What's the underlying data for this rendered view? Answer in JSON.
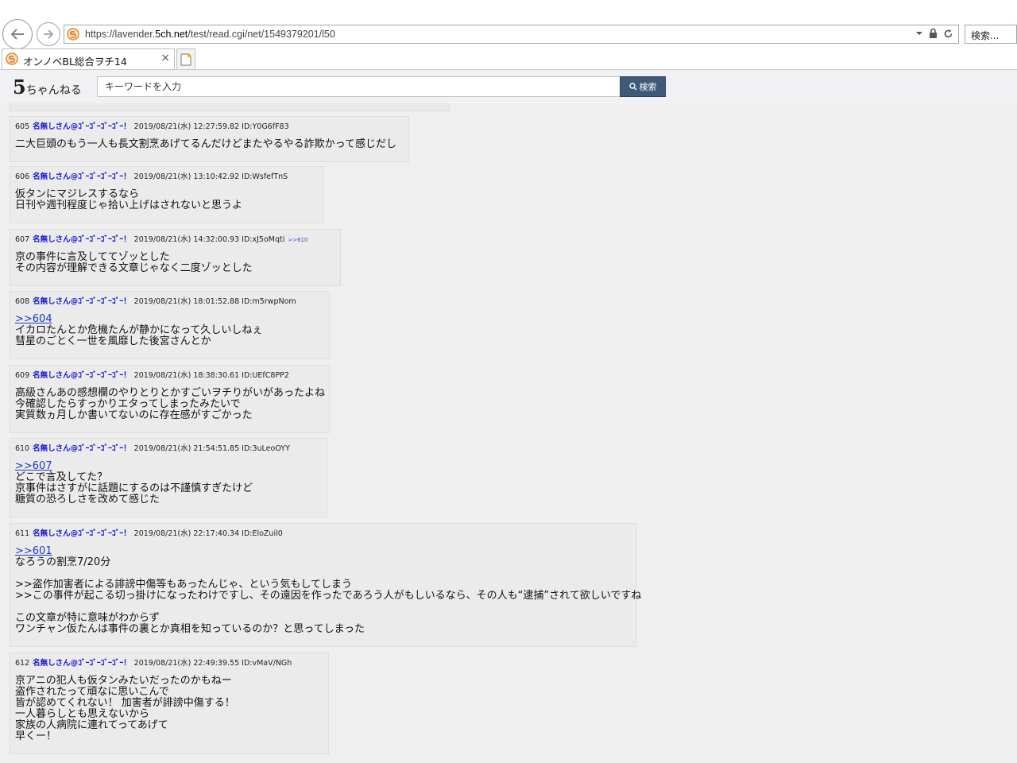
{
  "browser": {
    "url_prefix": "https://lavender.",
    "url_domain": "5ch.net",
    "url_path": "/test/read.cgi/net/1549379201/l50",
    "search_placeholder": "検索...",
    "tab_title": "オンノベBL総合ヲチ14",
    "tab_close": "×"
  },
  "site": {
    "logo_five": "5",
    "logo_rest": "ちゃんねる",
    "keyword_placeholder": "キーワードを入力",
    "search_label": "検索"
  },
  "posts": [
    {
      "num": "605",
      "name": "名無しさん@ｺﾞｰｺﾞｰｺﾞｰｺﾞｰ！",
      "datetime": "2019/08/21(水) 12:27:59.82",
      "id": "ID:Y0G6fF83",
      "tag": "",
      "lines": [
        "二大巨頭のもう一人も長文割烹あげてるんだけどまたやるやる詐欺かって感じだし"
      ]
    },
    {
      "num": "606",
      "name": "名無しさん@ｺﾞｰｺﾞｰｺﾞｰｺﾞｰ！",
      "datetime": "2019/08/21(水) 13:10:42.92",
      "id": "ID:WsfefTnS",
      "tag": "",
      "lines": [
        "仮タンにマジレスするなら",
        "日刊や週刊程度じゃ拾い上げはされないと思うよ"
      ]
    },
    {
      "num": "607",
      "name": "名無しさん@ｺﾞｰｺﾞｰｺﾞｰｺﾞｰ！",
      "datetime": "2019/08/21(水) 14:32:00.93",
      "id": "ID:xJ5oMqti",
      "tag": ">>610",
      "lines": [
        "京の事件に言及しててゾッとした",
        "その内容が理解できる文章じゃなく二度ゾッとした"
      ]
    },
    {
      "num": "608",
      "name": "名無しさん@ｺﾞｰｺﾞｰｺﾞｰｺﾞｰ！",
      "datetime": "2019/08/21(水) 18:01:52.88",
      "id": "ID:m5rwpNom",
      "tag": "",
      "anchor": ">>604",
      "lines": [
        "イカロたんとか危機たんが静かになって久しいしねぇ",
        "彗星のごとく一世を風靡した後宮さんとか"
      ]
    },
    {
      "num": "609",
      "name": "名無しさん@ｺﾞｰｺﾞｰｺﾞｰｺﾞｰ！",
      "datetime": "2019/08/21(水) 18:38:30.61",
      "id": "ID:UEfC8PP2",
      "tag": "",
      "lines": [
        "高級さんあの感想欄のやりとりとかすごいヲチりがいがあったよね",
        "今確認したらすっかりエタってしまったみたいで",
        "実質数ヵ月しか書いてないのに存在感がすごかった"
      ]
    },
    {
      "num": "610",
      "name": "名無しさん@ｺﾞｰｺﾞｰｺﾞｰｺﾞｰ！",
      "datetime": "2019/08/21(水) 21:54:51.85",
      "id": "ID:3uLeoOYY",
      "tag": "",
      "anchor": ">>607",
      "lines": [
        "どこで言及してた？",
        "京事件はさすがに話題にするのは不謹慎すぎたけど",
        "糖質の恐ろしさを改めて感じた"
      ]
    },
    {
      "num": "611",
      "name": "名無しさん@ｺﾞｰｺﾞｰｺﾞｰｺﾞｰ！",
      "datetime": "2019/08/21(水) 22:17:40.34",
      "id": "ID:EloZuil0",
      "tag": "",
      "anchor": ">>601",
      "lines": [
        "なろうの割烹7/20分",
        "",
        ">>盗作加害者による誹謗中傷等もあったんじゃ、という気もしてしまう",
        ">>この事件が起こる切っ掛けになったわけですし、その遠因を作ったであろう人がもしいるなら、その人も“逮捕”されて欲しいですね",
        "",
        "この文章が特に意味がわからず",
        "ワンチャン仮たんは事件の裏とか真相を知っているのか？と思ってしまった"
      ]
    },
    {
      "num": "612",
      "name": "名無しさん@ｺﾞｰｺﾞｰｺﾞｰｺﾞｰ！",
      "datetime": "2019/08/21(水) 22:49:39.55",
      "id": "ID:vMaV/NGh",
      "tag": "",
      "lines": [
        "京アニの犯人も仮タンみたいだったのかもねー",
        "盗作されたって頑なに思いこんで",
        "皆が認めてくれない！ 加害者が誹謗中傷する！",
        "一人暮らしとも思えないから",
        "家族の人病院に連れてってあげて",
        "早くー！"
      ]
    }
  ]
}
